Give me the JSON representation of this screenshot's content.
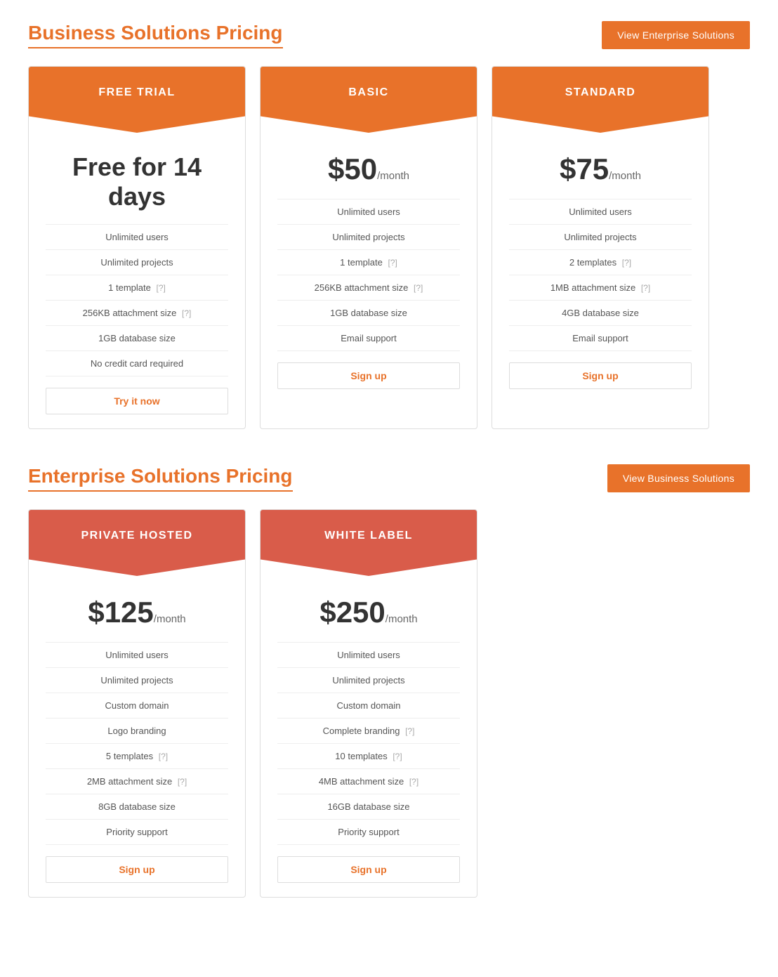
{
  "business_section": {
    "title": "Business Solutions Pricing",
    "view_btn": "View Enterprise Solutions",
    "plans": [
      {
        "id": "free-trial",
        "header": "FREE TRIAL",
        "header_color": "orange",
        "price_type": "free",
        "price_text": "Free for 14 days",
        "features": [
          {
            "text": "Unlimited users",
            "help": null
          },
          {
            "text": "Unlimited projects",
            "help": null
          },
          {
            "text": "1 template",
            "help": "[?]"
          },
          {
            "text": "256KB attachment size",
            "help": "[?]"
          },
          {
            "text": "1GB database size",
            "help": null
          },
          {
            "text": "No credit card required",
            "help": null
          }
        ],
        "cta": "Try it now",
        "cta_href": "#"
      },
      {
        "id": "basic",
        "header": "BASIC",
        "header_color": "orange",
        "price_type": "paid",
        "price_amount": "$50",
        "price_period": "/month",
        "features": [
          {
            "text": "Unlimited users",
            "help": null
          },
          {
            "text": "Unlimited projects",
            "help": null
          },
          {
            "text": "1 template",
            "help": "[?]"
          },
          {
            "text": "256KB attachment size",
            "help": "[?]"
          },
          {
            "text": "1GB database size",
            "help": null
          },
          {
            "text": "Email support",
            "help": null
          }
        ],
        "cta": "Sign up",
        "cta_href": "#"
      },
      {
        "id": "standard",
        "header": "STANDARD",
        "header_color": "orange",
        "price_type": "paid",
        "price_amount": "$75",
        "price_period": "/month",
        "features": [
          {
            "text": "Unlimited users",
            "help": null
          },
          {
            "text": "Unlimited projects",
            "help": null
          },
          {
            "text": "2 templates",
            "help": "[?]"
          },
          {
            "text": "1MB attachment size",
            "help": "[?]"
          },
          {
            "text": "4GB database size",
            "help": null
          },
          {
            "text": "Email support",
            "help": null
          }
        ],
        "cta": "Sign up",
        "cta_href": "#"
      }
    ]
  },
  "enterprise_section": {
    "title": "Enterprise Solutions Pricing",
    "view_btn": "View Business Solutions",
    "plans": [
      {
        "id": "private-hosted",
        "header": "PRIVATE HOSTED",
        "header_color": "red",
        "price_type": "paid",
        "price_amount": "$125",
        "price_period": "/month",
        "features": [
          {
            "text": "Unlimited users",
            "help": null
          },
          {
            "text": "Unlimited projects",
            "help": null
          },
          {
            "text": "Custom domain",
            "help": null
          },
          {
            "text": "Logo branding",
            "help": null
          },
          {
            "text": "5 templates",
            "help": "[?]"
          },
          {
            "text": "2MB attachment size",
            "help": "[?]"
          },
          {
            "text": "8GB database size",
            "help": null
          },
          {
            "text": "Priority support",
            "help": null
          }
        ],
        "cta": "Sign up",
        "cta_href": "#"
      },
      {
        "id": "white-label",
        "header": "WHITE LABEL",
        "header_color": "red",
        "price_type": "paid",
        "price_amount": "$250",
        "price_period": "/month",
        "features": [
          {
            "text": "Unlimited users",
            "help": null
          },
          {
            "text": "Unlimited projects",
            "help": null
          },
          {
            "text": "Custom domain",
            "help": null
          },
          {
            "text": "Complete branding",
            "help": "[?]"
          },
          {
            "text": "10 templates",
            "help": "[?]"
          },
          {
            "text": "4MB attachment size",
            "help": "[?]"
          },
          {
            "text": "16GB database size",
            "help": null
          },
          {
            "text": "Priority support",
            "help": null
          }
        ],
        "cta": "Sign up",
        "cta_href": "#"
      }
    ]
  }
}
